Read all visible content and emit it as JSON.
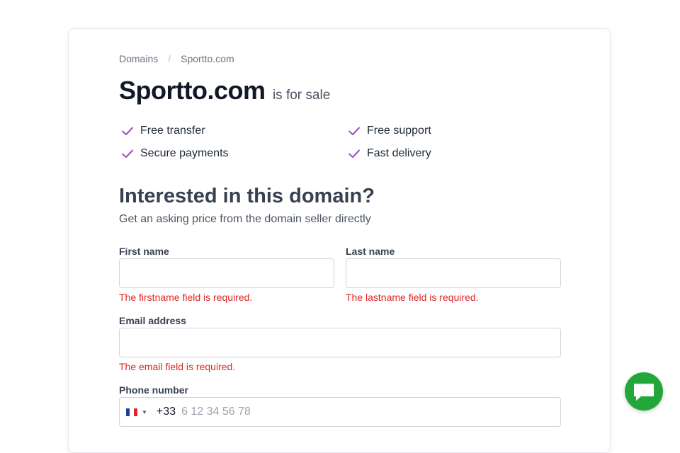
{
  "breadcrumb": {
    "root": "Domains",
    "separator": "/",
    "current": "Sportto.com"
  },
  "header": {
    "domain": "Sportto.com",
    "suffix": "is for sale"
  },
  "features": [
    {
      "label": "Free transfer",
      "icon": "check-icon"
    },
    {
      "label": "Free support",
      "icon": "check-icon"
    },
    {
      "label": "Secure payments",
      "icon": "check-icon"
    },
    {
      "label": "Fast delivery",
      "icon": "check-icon"
    }
  ],
  "form": {
    "heading": "Interested in this domain?",
    "subheading": "Get an asking price from the domain seller directly",
    "first_name": {
      "label": "First name",
      "value": "",
      "error": "The firstname field is required."
    },
    "last_name": {
      "label": "Last name",
      "value": "",
      "error": "The lastname field is required."
    },
    "email": {
      "label": "Email address",
      "value": "",
      "error": "The email field is required."
    },
    "phone": {
      "label": "Phone number",
      "country": "FR",
      "dial_code": "+33",
      "placeholder": "6 12 34 56 78",
      "value": ""
    }
  },
  "colors": {
    "accent_check": "#9b4dca",
    "error": "#dc2626",
    "chat_button": "#22a83a"
  },
  "chat": {
    "icon": "chat-bubble-icon"
  }
}
